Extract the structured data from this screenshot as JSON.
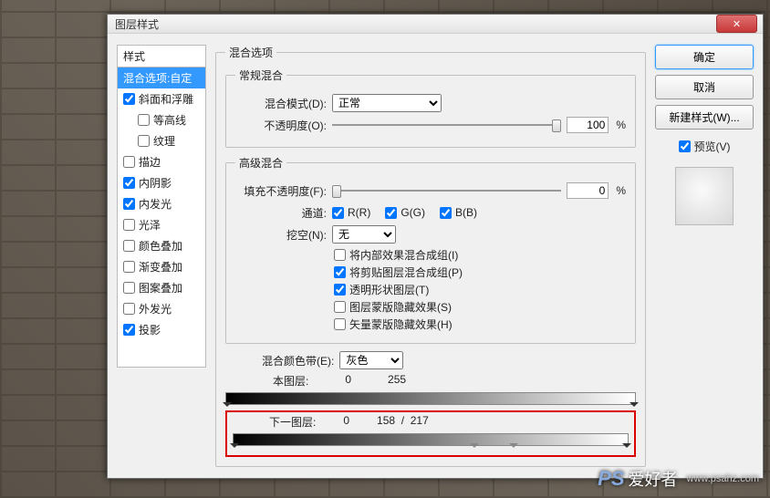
{
  "dialog": {
    "title": "图层样式"
  },
  "styles": {
    "header": "样式",
    "selected": "混合选项:自定",
    "items": [
      {
        "label": "斜面和浮雕",
        "checked": true
      },
      {
        "label": "等高线",
        "checked": false,
        "indent": true
      },
      {
        "label": "纹理",
        "checked": false,
        "indent": true
      },
      {
        "label": "描边",
        "checked": false
      },
      {
        "label": "内阴影",
        "checked": true
      },
      {
        "label": "内发光",
        "checked": true
      },
      {
        "label": "光泽",
        "checked": false
      },
      {
        "label": "颜色叠加",
        "checked": false
      },
      {
        "label": "渐变叠加",
        "checked": false
      },
      {
        "label": "图案叠加",
        "checked": false
      },
      {
        "label": "外发光",
        "checked": false
      },
      {
        "label": "投影",
        "checked": true
      }
    ]
  },
  "blend": {
    "legend": "混合选项",
    "general_legend": "常规混合",
    "mode_label": "混合模式(D):",
    "mode_value": "正常",
    "opacity_label": "不透明度(O):",
    "opacity_value": "100",
    "opacity_unit": "%",
    "advanced_legend": "高级混合",
    "fill_label": "填充不透明度(F):",
    "fill_value": "0",
    "fill_unit": "%",
    "channel_label": "通道:",
    "channel_r": "R(R)",
    "channel_g": "G(G)",
    "channel_b": "B(B)",
    "knockout_label": "挖空(N):",
    "knockout_value": "无",
    "cb1": "将内部效果混合成组(I)",
    "cb2": "将剪贴图层混合成组(P)",
    "cb3": "透明形状图层(T)",
    "cb4": "图层蒙版隐藏效果(S)",
    "cb5": "矢量蒙版隐藏效果(H)",
    "blendif_label": "混合颜色带(E):",
    "blendif_value": "灰色",
    "this_layer": "本图层:",
    "this_lo": "0",
    "this_hi": "255",
    "under_layer": "下一图层:",
    "under_lo": "0",
    "under_mid": "158",
    "under_slash": "/",
    "under_hi": "217"
  },
  "buttons": {
    "ok": "确定",
    "cancel": "取消",
    "newstyle": "新建样式(W)...",
    "preview": "预览(V)"
  },
  "watermark": {
    "ps": "PS",
    "text": "爱好者",
    "url": "www.psahz.com"
  }
}
